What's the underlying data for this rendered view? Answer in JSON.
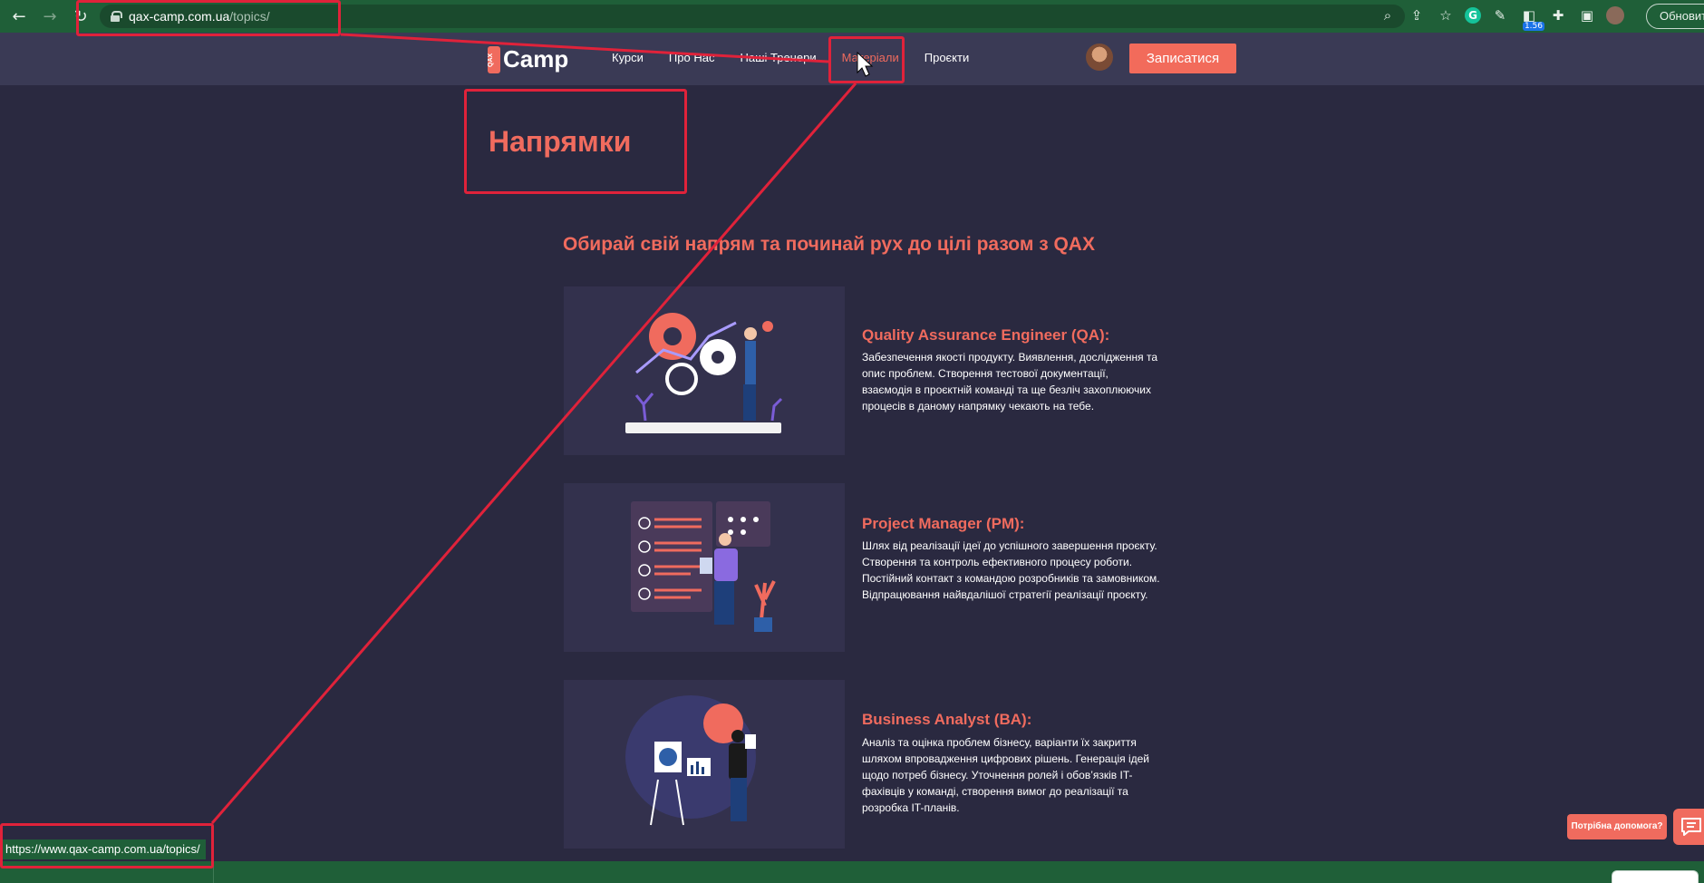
{
  "browser": {
    "url_host": "qax-camp.com.ua",
    "url_path": "/topics/",
    "extension_badge": "1.56",
    "update_label": "Обновить",
    "status_url": "https://www.qax-camp.com.ua/topics/"
  },
  "header": {
    "logo_badge": "QAX",
    "logo_text": "Camp",
    "menu": [
      {
        "label": "Курси"
      },
      {
        "label": "Про Нас"
      },
      {
        "label": "Наші Тренери"
      },
      {
        "label": "Матеріали"
      },
      {
        "label": "Проєкти"
      }
    ],
    "cta_label": "Записатися"
  },
  "main": {
    "title": "Напрямки",
    "subtitle": "Обирай свій напрям та починай рух до цілі разом з QAX",
    "cards": [
      {
        "title": "Quality Assurance Engineer (QA):",
        "desc": "Забезпечення якості продукту. Виявлення, дослідження та опис проблем. Створення тестової документації, взаємодія в проєктній команді та ще безліч захоплюючих процесів в даному напрямку чекають на тебе."
      },
      {
        "title": "Project Manager (PM):",
        "desc": "Шлях від реалізації ідеї до успішного завершення проєкту. Створення та контроль ефективного процесу роботи. Постійний контакт з командою розробників та замовником. Відпрацювання найвдалішої стратегії реалізації проєкту."
      },
      {
        "title": "Business Analyst (BA):",
        "desc": "Аналіз та оцінка проблем бізнесу, варіанти їх закриття шляхом впровадження цифрових рішень. Генерація ідей щодо потреб бізнесу. Уточнення ролей і обов’язків IT-фахівців у команді, створення вимог до реалізації та розробка IT-планів."
      }
    ]
  },
  "help": {
    "label": "Потрібна допомога?"
  },
  "colors": {
    "accent": "#f06b5e",
    "annotation": "#e0223a",
    "chrome": "#1f5f38",
    "background": "#2a2940"
  }
}
